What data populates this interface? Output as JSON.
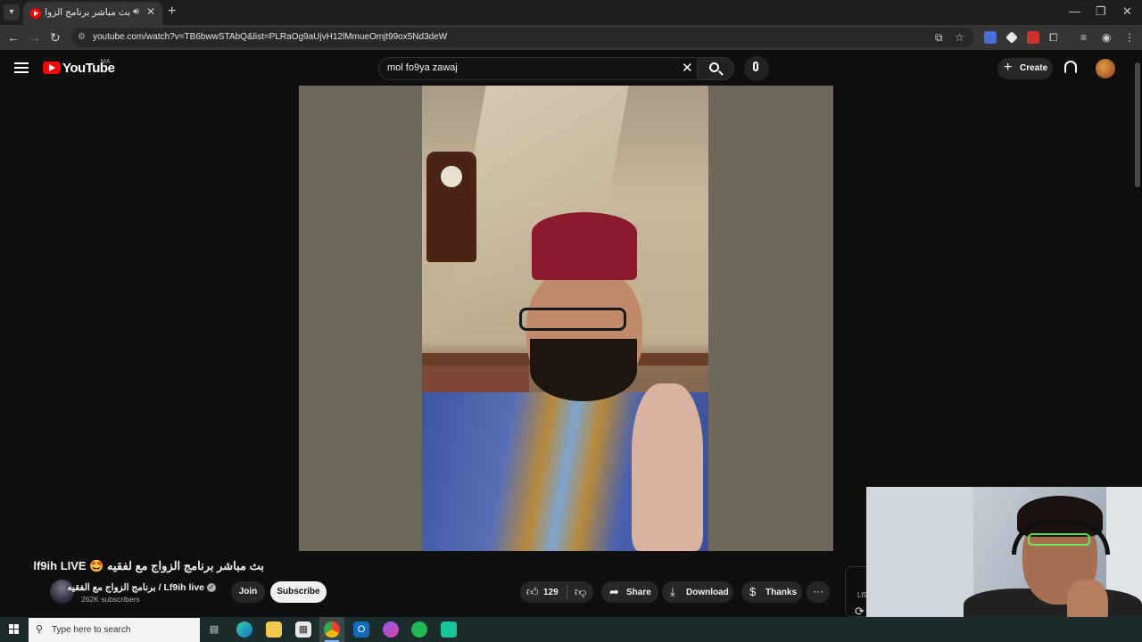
{
  "browser": {
    "tab_title": "بث مباشر برنامج الزواج مع لف",
    "tab_audio_icon": "speaker-icon",
    "url": "youtube.com/watch?v=TB6bwwSTAbQ&list=PLRaOg9aUjvH12lMmueOmjt99ox5Nd3deW"
  },
  "youtube": {
    "logo_text": "YouTube",
    "region": "MA",
    "search_value": "mol fo9ya zawaj",
    "create_label": "Create"
  },
  "video": {
    "title": "بث مباشر برنامج الزواج مع لفقيه 🤩 lf9ih LIVE",
    "channel_name": "Lf9ih live / برنامج الزواج مع الفقيه",
    "subscribers": "262K subscribers",
    "join_label": "Join",
    "subscribe_label": "Subscribe",
    "likes": "129",
    "share_label": "Share",
    "download_label": "Download",
    "thanks_label": "Thanks",
    "side_card_text": "Lf9"
  },
  "taskbar": {
    "search_placeholder": "Type here to search"
  },
  "colors": {
    "youtube_red": "#ff0000",
    "background": "#0f0f0f",
    "pill_bg": "#272727"
  }
}
